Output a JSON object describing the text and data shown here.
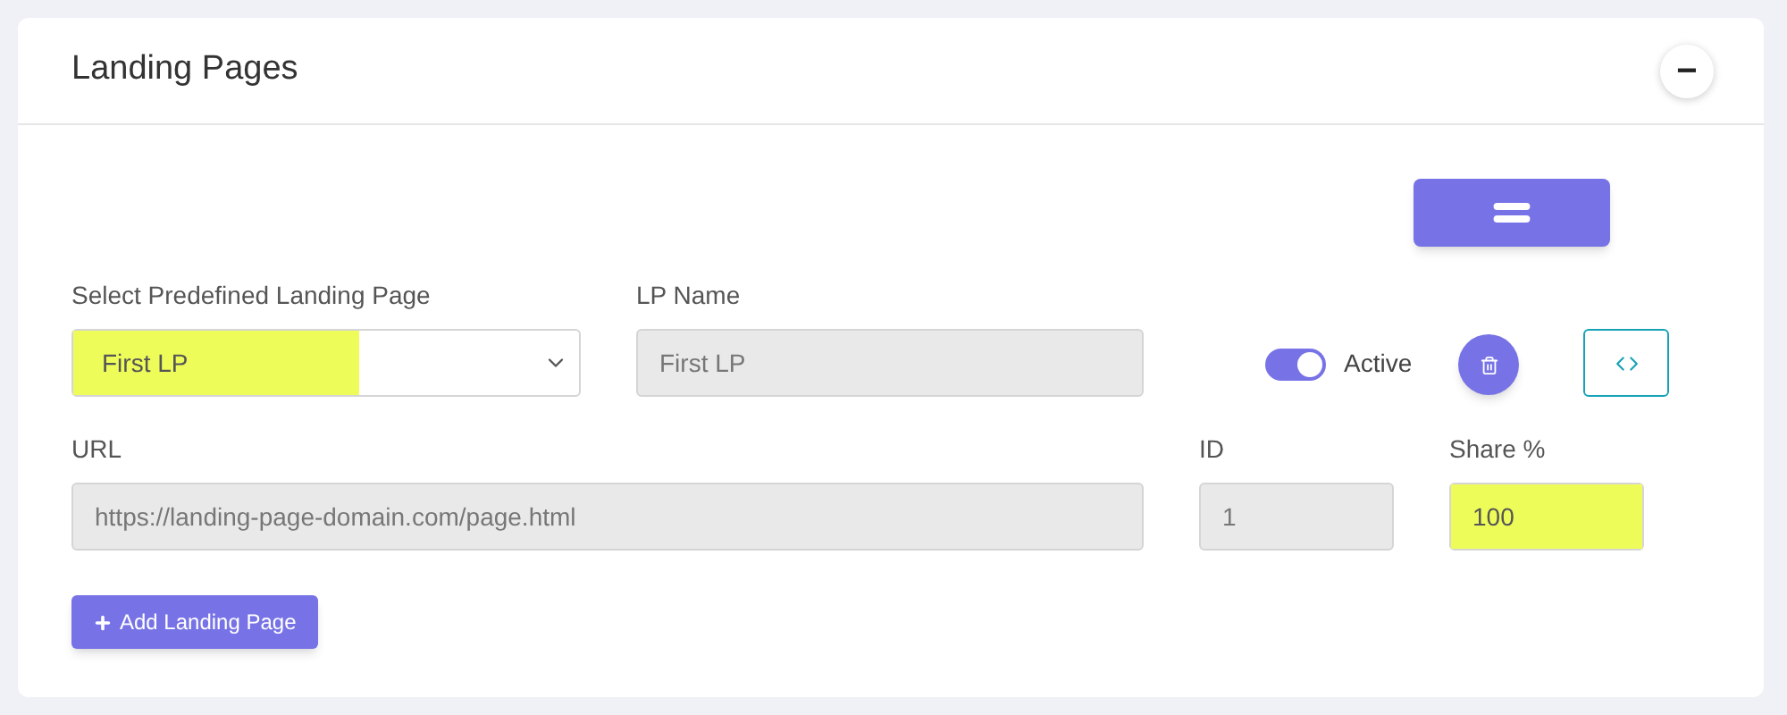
{
  "card": {
    "title": "Landing Pages",
    "collapse_icon": "−"
  },
  "landing_page": {
    "select": {
      "label": "Select Predefined Landing Page",
      "value": "First LP",
      "highlighted": true
    },
    "lp_name": {
      "label": "LP Name",
      "value": "First LP",
      "disabled": true
    },
    "active": {
      "label": "Active",
      "on": true
    },
    "url": {
      "label": "URL",
      "value": "https://landing-page-domain.com/page.html",
      "disabled": true
    },
    "id": {
      "label": "ID",
      "value": "1",
      "disabled": true
    },
    "share": {
      "label": "Share %",
      "value": "100",
      "highlighted": true
    }
  },
  "add_button": {
    "label": "Add Landing Page"
  }
}
